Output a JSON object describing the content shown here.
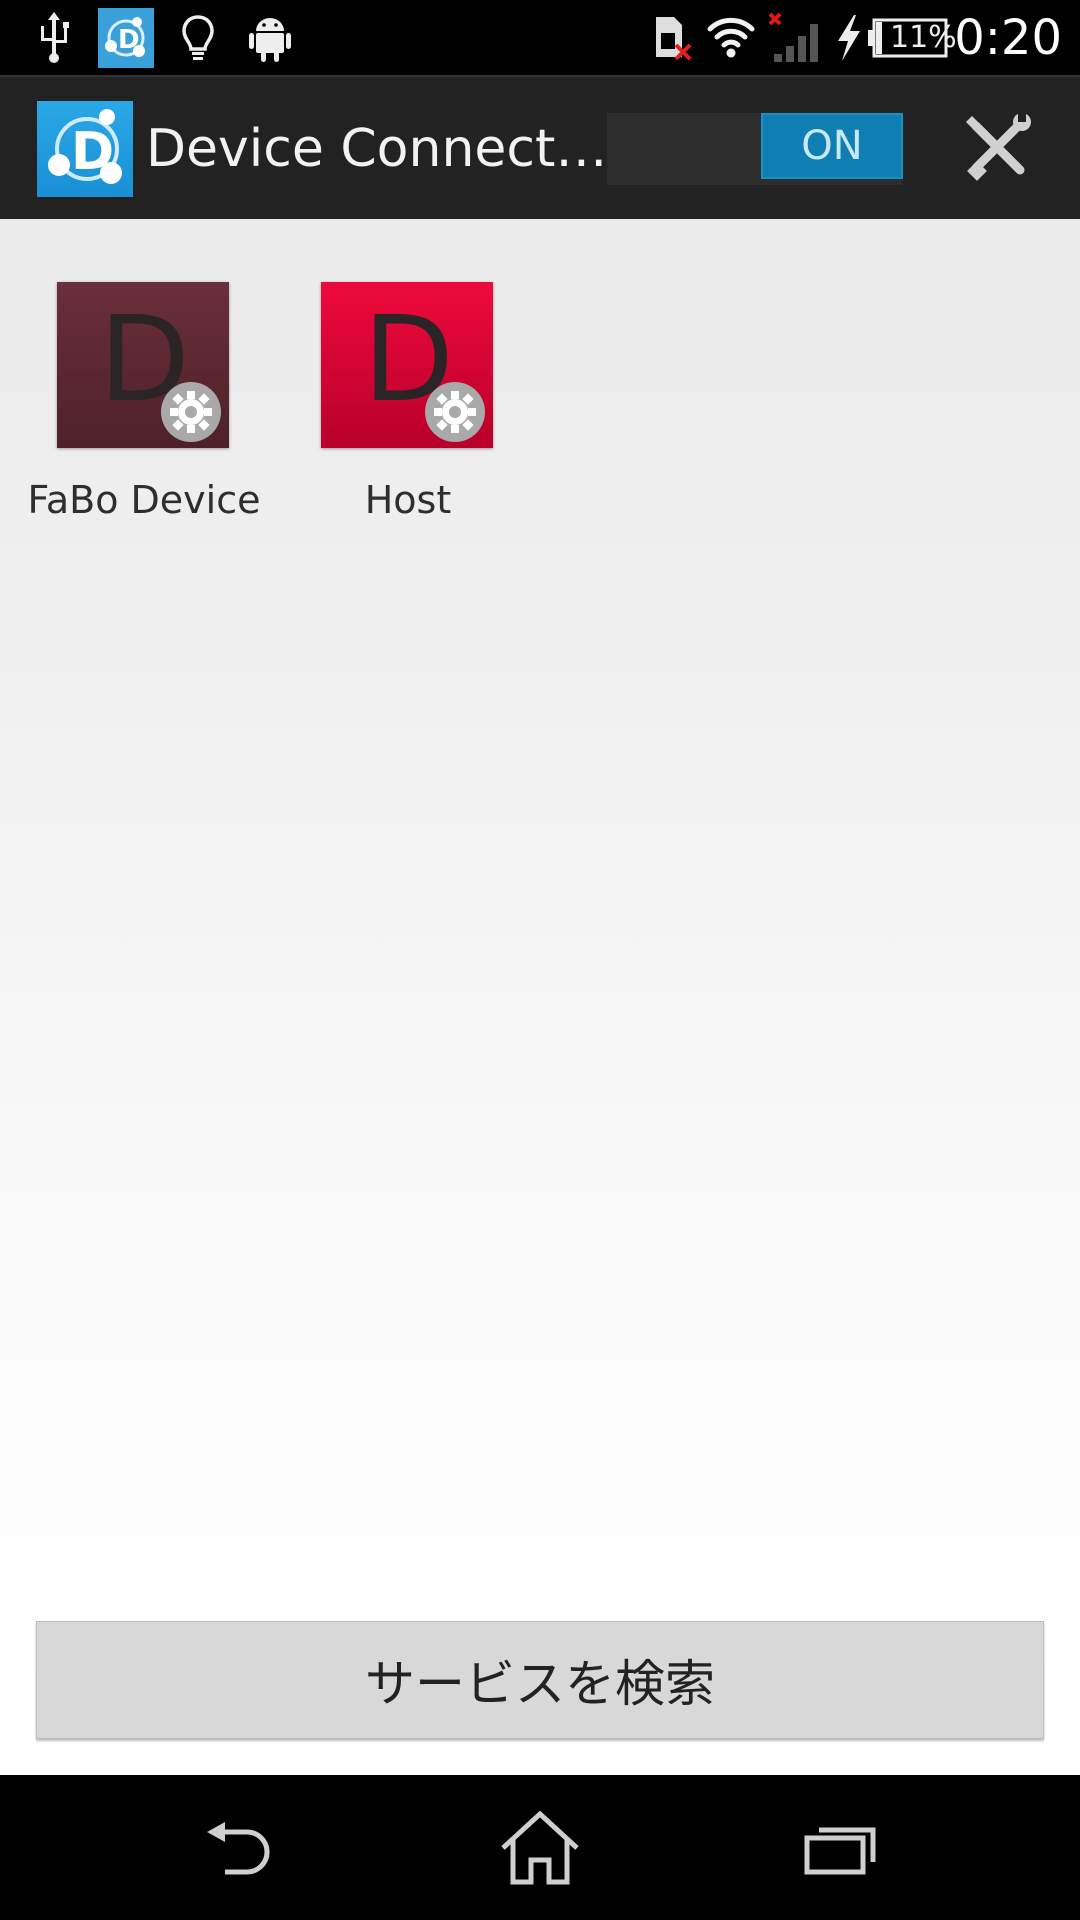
{
  "status_bar": {
    "time": "0:20",
    "battery_percent": "11%",
    "icons": [
      "usb-icon",
      "device-connect-notification-icon",
      "lightbulb-icon",
      "android-icon",
      "no-sim-icon",
      "wifi-icon",
      "signal-no-service-icon",
      "charging-icon",
      "battery-icon"
    ]
  },
  "action_bar": {
    "title": "Device Connect…",
    "toggle_label": "ON",
    "toggle_state": "on",
    "settings_icon": "wrench-screwdriver-icon"
  },
  "devices": [
    {
      "label": "FaBo Device",
      "letter": "D",
      "color": "#5a2a32"
    },
    {
      "label": "Host",
      "letter": "D",
      "color": "#d4002e"
    }
  ],
  "search_button": {
    "label": "サービスを検索"
  },
  "nav_bar": {
    "icons": [
      "back-icon",
      "home-icon",
      "recent-apps-icon"
    ]
  }
}
